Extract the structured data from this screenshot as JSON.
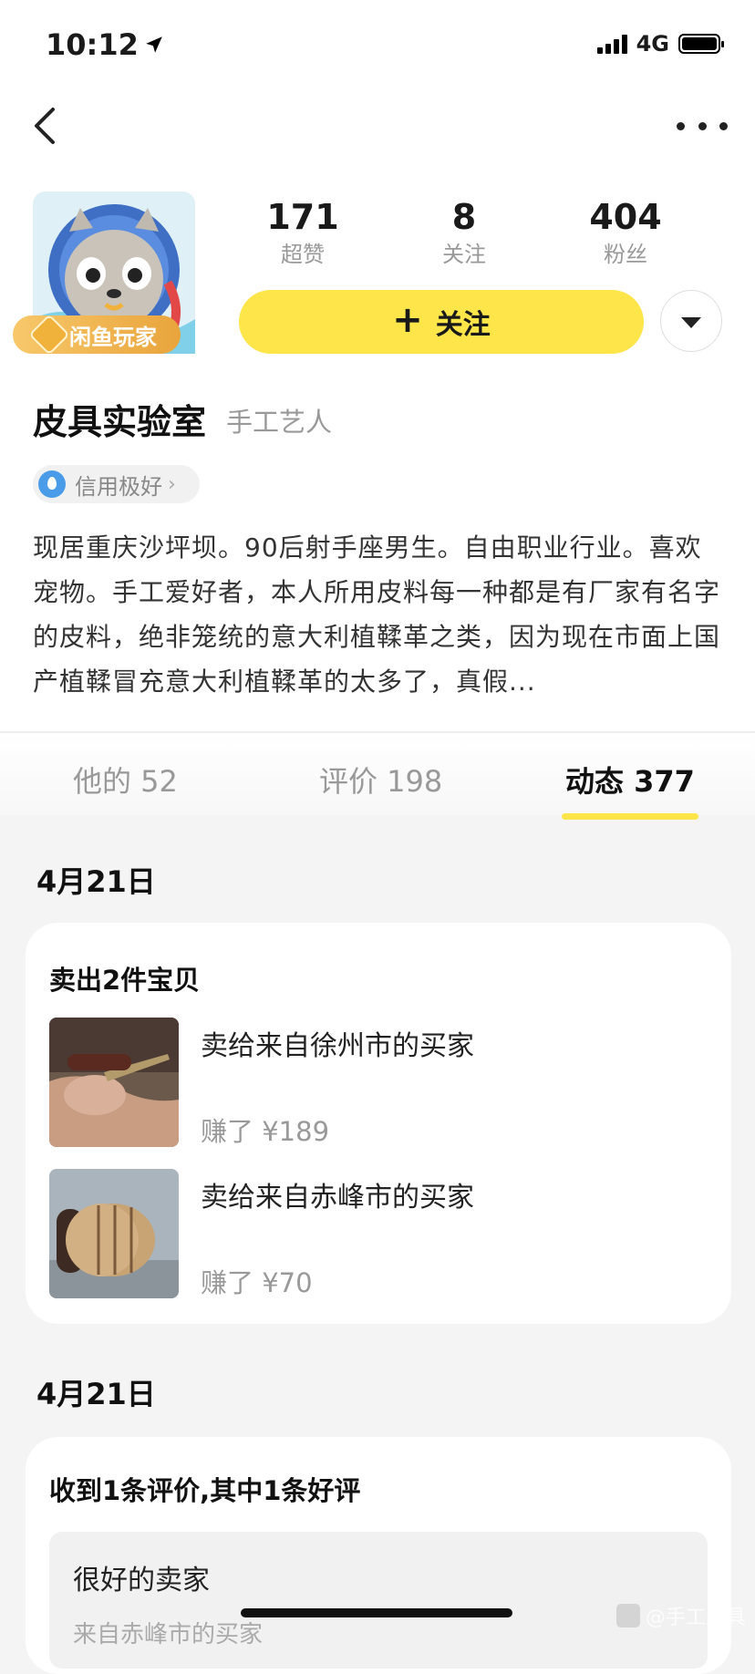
{
  "status_bar": {
    "time": "10:12",
    "network": "4G"
  },
  "profile": {
    "stats": [
      {
        "value": "171",
        "label": "超赞"
      },
      {
        "value": "8",
        "label": "关注"
      },
      {
        "value": "404",
        "label": "粉丝"
      }
    ],
    "badge": "闲鱼玩家",
    "follow_label": "关注",
    "name": "皮具实验室",
    "role": "手工艺人",
    "credit": "信用极好",
    "bio": "现居重庆沙坪坝。90后射手座男生。自由职业行业。喜欢宠物。手工爱好者，本人所用皮料每一种都是有厂家有名字的皮料，绝非笼统的意大利植鞣革之类，因为现在市面上国产植鞣冒充意大利植鞣革的太多了，真假..."
  },
  "tabs": [
    {
      "label": "他的 52"
    },
    {
      "label": "评价 198"
    },
    {
      "label": "动态 377"
    }
  ],
  "feed": [
    {
      "date": "4月21日",
      "title": "卖出2件宝贝",
      "items": [
        {
          "buyer": "卖给来自徐州市的买家",
          "earned": "赚了 ¥189"
        },
        {
          "buyer": "卖给来自赤峰市的买家",
          "earned": "赚了 ¥70"
        }
      ]
    },
    {
      "date": "4月21日",
      "title": "收到1条评价,其中1条好评",
      "review": {
        "text": "很好的卖家",
        "source": "来自赤峰市的买家"
      }
    }
  ],
  "watermark": "@手工皮具"
}
